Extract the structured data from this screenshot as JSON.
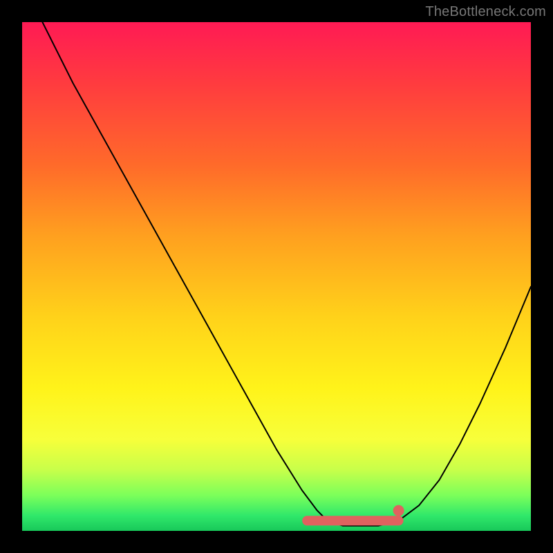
{
  "watermark": "TheBottleneck.com",
  "colors": {
    "frame": "#000000",
    "curve": "#000000",
    "accent": "#e0625f",
    "gradient_top": "#ff1a54",
    "gradient_bottom": "#18c85a"
  },
  "chart_data": {
    "type": "line",
    "title": "",
    "xlabel": "",
    "ylabel": "",
    "xlim": [
      0,
      100
    ],
    "ylim": [
      0,
      100
    ],
    "note": "Axes are percentage of plot area; y is bottleneck % (0 at bottom, 100 at top). Values estimated from pixels.",
    "series": [
      {
        "name": "bottleneck-curve",
        "x": [
          4,
          10,
          15,
          20,
          25,
          30,
          35,
          40,
          45,
          50,
          55,
          58,
          60,
          63,
          66,
          70,
          74,
          78,
          82,
          86,
          90,
          95,
          100
        ],
        "y": [
          100,
          88,
          79,
          70,
          61,
          52,
          43,
          34,
          25,
          16,
          8,
          4,
          2,
          1,
          1,
          1,
          2,
          5,
          10,
          17,
          25,
          36,
          48
        ]
      }
    ],
    "flat_region": {
      "x_start": 56,
      "x_end": 74,
      "y": 2
    },
    "marker": {
      "x": 74,
      "y": 4
    }
  }
}
